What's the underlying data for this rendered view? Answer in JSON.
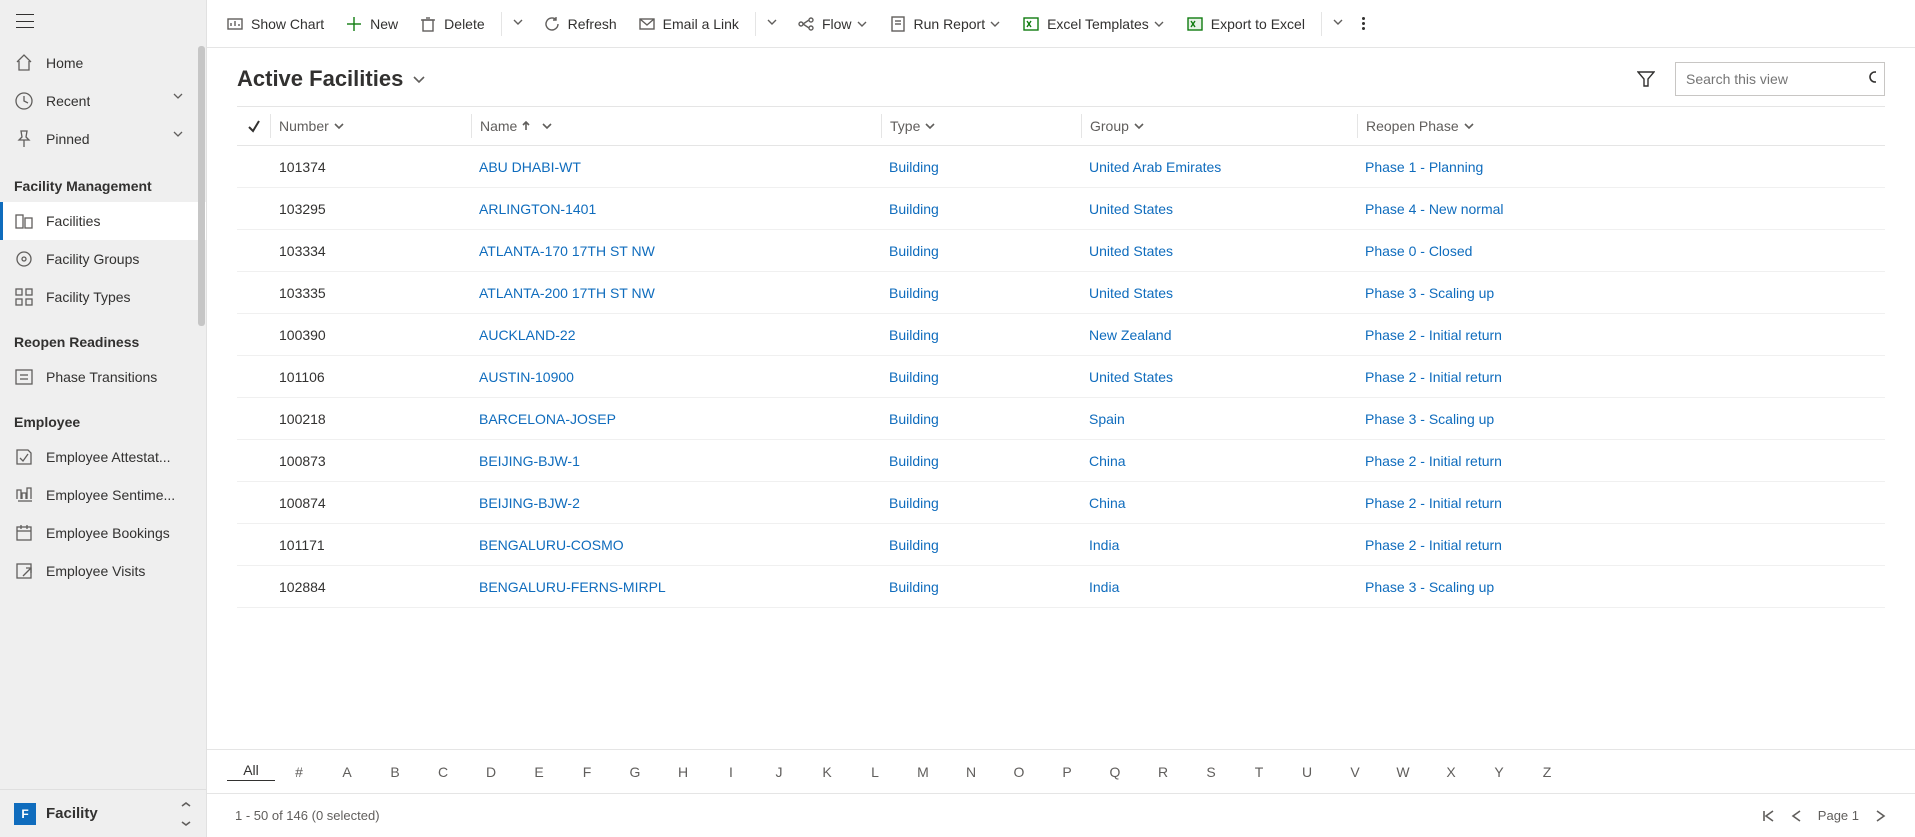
{
  "sidebar": {
    "top": [
      {
        "key": "home",
        "label": "Home"
      },
      {
        "key": "recent",
        "label": "Recent",
        "expandable": true
      },
      {
        "key": "pinned",
        "label": "Pinned",
        "expandable": true
      }
    ],
    "groups": [
      {
        "title": "Facility Management",
        "items": [
          {
            "key": "facilities",
            "label": "Facilities",
            "active": true
          },
          {
            "key": "facility-groups",
            "label": "Facility Groups"
          },
          {
            "key": "facility-types",
            "label": "Facility Types"
          }
        ]
      },
      {
        "title": "Reopen Readiness",
        "items": [
          {
            "key": "phase-transitions",
            "label": "Phase Transitions"
          }
        ]
      },
      {
        "title": "Employee",
        "items": [
          {
            "key": "emp-attest",
            "label": "Employee Attestat..."
          },
          {
            "key": "emp-sentiment",
            "label": "Employee Sentime..."
          },
          {
            "key": "emp-bookings",
            "label": "Employee Bookings"
          },
          {
            "key": "emp-visits",
            "label": "Employee Visits"
          }
        ]
      }
    ],
    "footer": {
      "tile": "F",
      "label": "Facility"
    }
  },
  "commands": {
    "show_chart": "Show Chart",
    "new": "New",
    "delete": "Delete",
    "refresh": "Refresh",
    "email_link": "Email a Link",
    "flow": "Flow",
    "run_report": "Run Report",
    "excel_templates": "Excel Templates",
    "export_excel": "Export to Excel"
  },
  "view": {
    "name": "Active Facilities",
    "search_placeholder": "Search this view"
  },
  "columns": {
    "number": "Number",
    "name": "Name",
    "type": "Type",
    "group": "Group",
    "reopen": "Reopen Phase"
  },
  "rows": [
    {
      "number": "101374",
      "name": "ABU DHABI-WT",
      "type": "Building",
      "group": "United Arab Emirates",
      "phase": "Phase 1 - Planning"
    },
    {
      "number": "103295",
      "name": "ARLINGTON-1401",
      "type": "Building",
      "group": "United States",
      "phase": "Phase 4 - New normal"
    },
    {
      "number": "103334",
      "name": "ATLANTA-170 17TH ST NW",
      "type": "Building",
      "group": "United States",
      "phase": "Phase 0 - Closed"
    },
    {
      "number": "103335",
      "name": "ATLANTA-200 17TH ST NW",
      "type": "Building",
      "group": "United States",
      "phase": "Phase 3 - Scaling up"
    },
    {
      "number": "100390",
      "name": "AUCKLAND-22",
      "type": "Building",
      "group": "New Zealand",
      "phase": "Phase 2 - Initial return"
    },
    {
      "number": "101106",
      "name": "AUSTIN-10900",
      "type": "Building",
      "group": "United States",
      "phase": "Phase 2 - Initial return"
    },
    {
      "number": "100218",
      "name": "BARCELONA-JOSEP",
      "type": "Building",
      "group": "Spain",
      "phase": "Phase 3 - Scaling up"
    },
    {
      "number": "100873",
      "name": "BEIJING-BJW-1",
      "type": "Building",
      "group": "China",
      "phase": "Phase 2 - Initial return"
    },
    {
      "number": "100874",
      "name": "BEIJING-BJW-2",
      "type": "Building",
      "group": "China",
      "phase": "Phase 2 - Initial return"
    },
    {
      "number": "101171",
      "name": "BENGALURU-COSMO",
      "type": "Building",
      "group": "India",
      "phase": "Phase 2 - Initial return"
    },
    {
      "number": "102884",
      "name": "BENGALURU-FERNS-MIRPL",
      "type": "Building",
      "group": "India",
      "phase": "Phase 3 - Scaling up"
    }
  ],
  "az": {
    "current": "All",
    "items": [
      "All",
      "#",
      "A",
      "B",
      "C",
      "D",
      "E",
      "F",
      "G",
      "H",
      "I",
      "J",
      "K",
      "L",
      "M",
      "N",
      "O",
      "P",
      "Q",
      "R",
      "S",
      "T",
      "U",
      "V",
      "W",
      "X",
      "Y",
      "Z"
    ]
  },
  "footer": {
    "status": "1 - 50 of 146 (0 selected)",
    "page_label": "Page 1"
  }
}
